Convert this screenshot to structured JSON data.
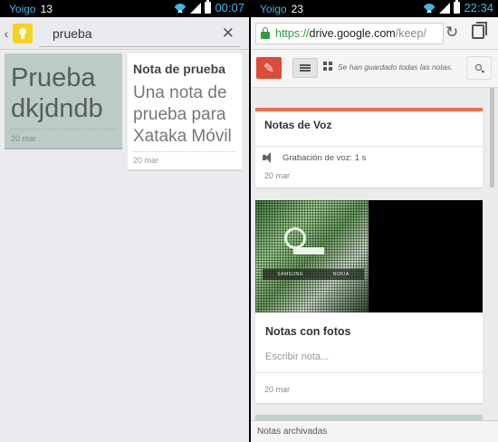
{
  "left": {
    "status": {
      "carrier": "Yoigo",
      "num": "13",
      "time": "00:07"
    },
    "search": {
      "query": "prueba"
    },
    "notes": [
      {
        "text": "Prueba dkjdndb",
        "date": "20 mar",
        "color": "#bccbc6"
      },
      {
        "title": "Nota de prueba",
        "body": "Una nota de prueba para Xataka Móvil",
        "date": "20 mar"
      }
    ]
  },
  "right": {
    "status": {
      "carrier": "Yoigo",
      "num": "23",
      "time": "22:34"
    },
    "browser": {
      "url_scheme": "https://",
      "url_host": "drive.google.com",
      "url_path": "/keep/"
    },
    "toolbar": {
      "saved_status": "Se han guardado todas las notas."
    },
    "notes": [
      {
        "title": "Notas de Voz",
        "audio_label": "Grabación de voz: 1 s",
        "date": "20 mar",
        "accent": "#ef6f4e"
      },
      {
        "title": "Notas con fotos",
        "placeholder": "Escribir nota...",
        "date": "20 mar",
        "photo_labels": [
          "SAMSUNG",
          "NOKIA"
        ]
      }
    ],
    "footer": {
      "archived_label": "Notas archivadas"
    }
  }
}
